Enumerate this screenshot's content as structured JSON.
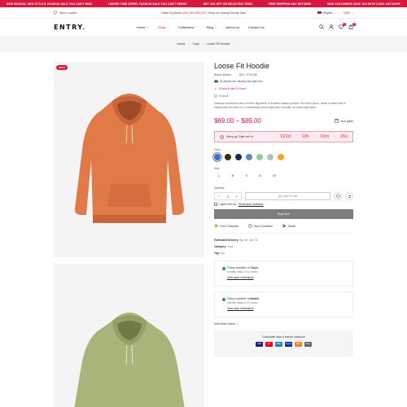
{
  "ticker": [
    "NEW SEASON, NEW STYLES: FASHION SALE YOU CAN'T MISS",
    "LIMITED TIME OFFER: FASHION SALE YOU CAN'T RESIST",
    "GET 10% OFF ON SELECTED ITEMS",
    "FREE SHIPPING AND RETURNS",
    "NEW CUSTOMERS SAVE 10% WITH CODE: GET10OFF"
  ],
  "util": {
    "store_locator": "Store Locator",
    "order_prefix": "Order by phone:",
    "phone": "(84) 943 496 102",
    "order_suffix": "| Shop our Spring Bounty Sale",
    "language": "English",
    "currency": "USD"
  },
  "header": {
    "logo": "ENTRY",
    "logo_dot": ".",
    "nav": [
      {
        "label": "Home",
        "has_menu": true
      },
      {
        "label": "Shop",
        "has_menu": true,
        "active": true
      },
      {
        "label": "Collections",
        "has_menu": true
      },
      {
        "label": "Blog",
        "has_menu": true
      },
      {
        "label": "About Us"
      },
      {
        "label": "Contact Us"
      }
    ],
    "wishlist_count": "0",
    "cart_count": "0"
  },
  "breadcrumb": [
    "Home",
    "Tops",
    "Loose Fit Hoodie"
  ],
  "breadcrumb_sep": "/",
  "gallery": {
    "sale_badge": "SALE"
  },
  "product": {
    "title": "Loose Fit Hoodie",
    "brand_label": "Brand:",
    "brand": "Modno",
    "sku_label": "SKU:",
    "sku": "TOP-008",
    "viewing": "52 people are viewing this right now",
    "sold": "14 sold in last 24 hours",
    "stock": "In stock",
    "description": "Vivamus elementum dolor id dolor dignissim, in incidunt massa pulvinar. Sed enim purus, mollis et amet ante in, blandit quis sed dolor et. In scelerisque ipsum eget sem convallis, ac luctus eget diam.",
    "price": "$69.00 – $89.00",
    "size_guide": "Size guide",
    "timer_label": "Hurry up! Sale end in:",
    "countdown": [
      "622d",
      "19h",
      "01m",
      "26s"
    ],
    "color_label": "Color:",
    "colors": [
      {
        "name": "blue",
        "hex": "#2f6fd6",
        "selected": true
      },
      {
        "name": "dark-brown",
        "hex": "#3b2a1c"
      },
      {
        "name": "navy",
        "hex": "#1a2a55"
      },
      {
        "name": "steel-blue",
        "hex": "#5f8bb5"
      },
      {
        "name": "light-green",
        "hex": "#8fd08a"
      },
      {
        "name": "silver",
        "hex": "#bdbdbd"
      },
      {
        "name": "amber",
        "hex": "#f0a722"
      }
    ],
    "size_label": "Size:",
    "sizes": [
      "L",
      "M",
      "S",
      "XL",
      "XS"
    ],
    "quantity_label": "Quantity:",
    "quantity": "1",
    "add_to_cart": "Add To Cart",
    "agree_prefix": "I agree with the",
    "agree_link": "Terms and Conditions",
    "buy_now": "Buy Now",
    "compare": "Color Compare",
    "ask": "Ask A Question",
    "share": "Share",
    "delivery_label": "Estimated Delivery:",
    "delivery": "Apr 19 - Apr 24",
    "category_label": "Category:",
    "category": "Tops",
    "tag_label": "Tag:",
    "tag": "Top",
    "pickups": [
      {
        "prefix": "Pickup available at",
        "store": "Tokyo",
        "ready": "Usually ready in 24 hours",
        "link": "View store information"
      },
      {
        "prefix": "Pickup available at",
        "store": "Madrid",
        "ready": "Usually ready in 24 hours",
        "link": "View store information"
      }
    ],
    "more_stores": "View More Stores",
    "checkout_heading": "Guarantee safe & secure checkout",
    "payments": [
      {
        "name": "visa",
        "label": "VISA",
        "color": "#1a1f71"
      },
      {
        "name": "mastercard",
        "label": "MC",
        "color": "#eb001b"
      },
      {
        "name": "amex",
        "label": "AMEX",
        "color": "#2e77bb"
      },
      {
        "name": "paypal",
        "label": "PayPal",
        "color": "#003087"
      },
      {
        "name": "discover",
        "label": "DISC",
        "color": "#f58220"
      },
      {
        "name": "gpay",
        "label": "GPay",
        "color": "#5f6368"
      }
    ]
  },
  "colors": {
    "accent": "#d8173f",
    "hoodie_orange": "#e07a46",
    "hoodie_green": "#a8b57a"
  }
}
